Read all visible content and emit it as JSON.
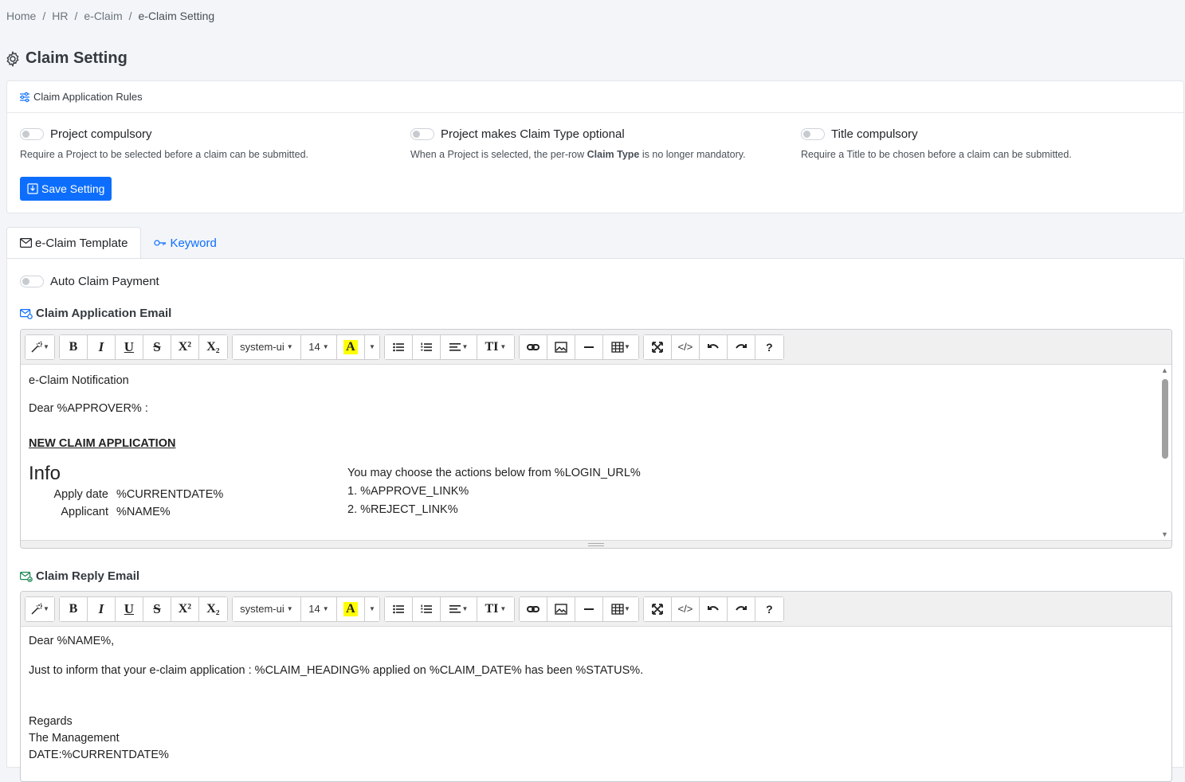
{
  "breadcrumb": [
    {
      "label": "Home"
    },
    {
      "label": "HR"
    },
    {
      "label": "e-Claim"
    },
    {
      "label": "e-Claim Setting"
    }
  ],
  "page": {
    "title": "Claim Setting"
  },
  "rules_card": {
    "heading": "Claim Application Rules",
    "rules": [
      {
        "label": "Project compulsory",
        "desc": "Require a Project to be selected before a claim can be submitted."
      },
      {
        "label": "Project makes Claim Type optional",
        "desc_pre": "When a Project is selected, the per-row ",
        "desc_bold": "Claim Type",
        "desc_post": " is no longer mandatory."
      },
      {
        "label": "Title compulsory",
        "desc": "Require a Title to be chosen before a claim can be submitted."
      }
    ],
    "save_label": "Save Setting"
  },
  "tabs": [
    {
      "label": "e-Claim Template"
    },
    {
      "label": "Keyword"
    }
  ],
  "template": {
    "auto_claim_label": "Auto Claim Payment",
    "toolbar": {
      "font": "system-ui",
      "size": "14",
      "bold": "B",
      "italic": "I",
      "underline": "U",
      "strike": "S",
      "superscript": "X²",
      "subscript": "X₂",
      "highlight": "A",
      "text_style": "TI",
      "code": "</>",
      "help": "?"
    },
    "application_email": {
      "title": "Claim Application Email",
      "notification": "e-Claim Notification",
      "greeting": "Dear %APPROVER% :",
      "heading": "NEW CLAIM APPLICATION",
      "info_title": "Info",
      "info_rows": [
        {
          "label": "Apply date",
          "value": "%CURRENTDATE%"
        },
        {
          "label": "Applicant",
          "value": "%NAME%"
        }
      ],
      "actions_intro": "You may choose the actions below from %LOGIN_URL%",
      "actions": [
        "1. %APPROVE_LINK%",
        "2. %REJECT_LINK%"
      ]
    },
    "reply_email": {
      "title": "Claim Reply Email",
      "greeting": "Dear %NAME%,",
      "body": "Just to inform that your e-claim application : %CLAIM_HEADING% applied on %CLAIM_DATE% has been %STATUS%.",
      "regards": "Regards",
      "signature": "The Management",
      "date_line": "DATE:%CURRENTDATE%"
    }
  }
}
